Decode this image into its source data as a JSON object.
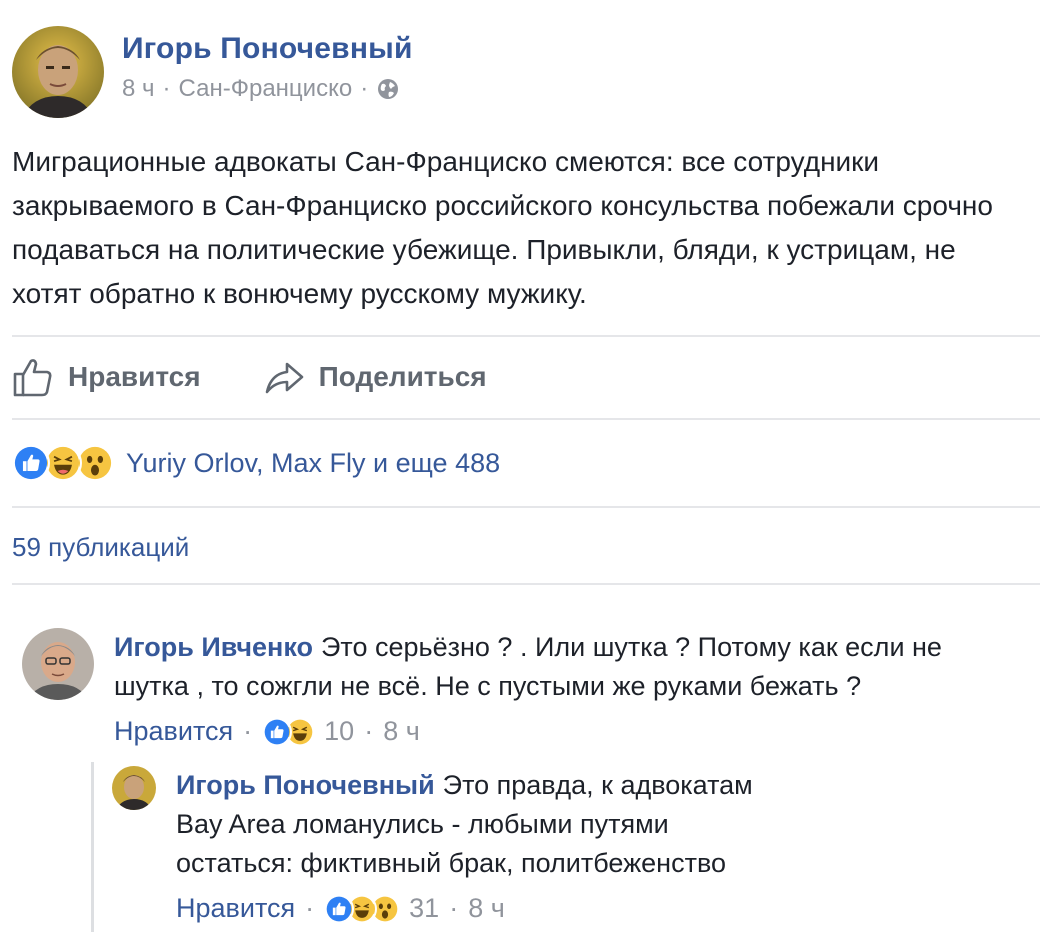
{
  "post": {
    "author": "Игорь Поночевный",
    "time": "8 ч",
    "location": "Сан-Франциско",
    "separator": "·",
    "text": "Миграционные адвокаты Сан-Франциско смеются: все сотрудники закрываемого в Сан-Франциско российского консульства побежали срочно подаваться на политические убежище. Привыкли, бляди, к устрицам, не хотят обратно к вонючему русскому мужику."
  },
  "actions": {
    "like_label": "Нравится",
    "share_label": "Поделиться"
  },
  "reactions": {
    "icons": [
      "like-reaction-icon",
      "haha-reaction-icon",
      "wow-reaction-icon"
    ],
    "summary": "Yuriy Orlov, Max Fly и еще 488"
  },
  "shares": {
    "label": "59 публикаций"
  },
  "comments": [
    {
      "author": "Игорь Ивченко",
      "text": "Это серьёзно ? . Или шутка ? Потому как если не шутка , то сожгли не всё. Не с пустыми же руками бежать ?",
      "like_label": "Нравится",
      "reaction_count": "10",
      "time": "8 ч"
    },
    {
      "author": "Игорь Поночевный",
      "text": "Это правда, к адвокатам Bay Area ломанулись - любыми путями остаться: фиктивный брак, политбеженство",
      "like_label": "Нравится",
      "reaction_count": "31",
      "time": "8 ч"
    }
  ],
  "colors": {
    "link": "#365899",
    "meta": "#90949c",
    "text": "#1d2129",
    "divider": "#e5e6e9",
    "like_blue": "#2e80f4",
    "emoji_yellow": "#f6c541"
  }
}
